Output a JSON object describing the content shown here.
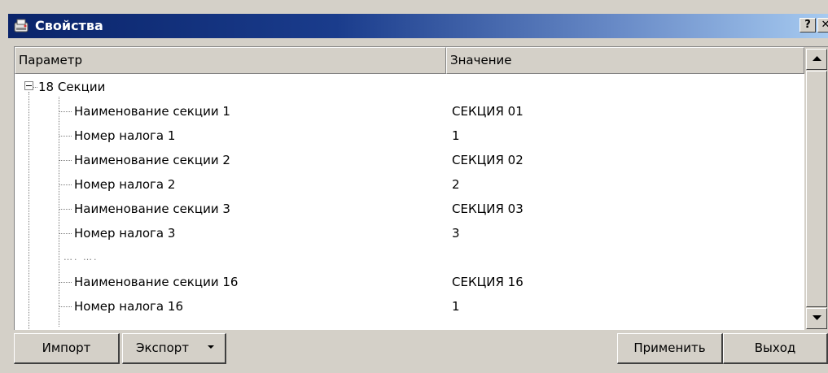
{
  "window": {
    "title": "Свойства",
    "help_label": "?",
    "close_label": "✕"
  },
  "grid": {
    "headers": [
      "Параметр",
      "Значение"
    ],
    "root": {
      "label": "18 Секции"
    },
    "rows": [
      {
        "label": "Наименование секции 1",
        "value": "СЕКЦИЯ 01"
      },
      {
        "label": "Номер налога 1",
        "value": "1"
      },
      {
        "label": "Наименование секции 2",
        "value": "СЕКЦИЯ 02"
      },
      {
        "label": "Номер налога 2",
        "value": "2"
      },
      {
        "label": "Наименование секции 3",
        "value": "СЕКЦИЯ 03"
      },
      {
        "label": "Номер налога 3",
        "value": "3"
      },
      {
        "label": "…. ….",
        "value": ""
      },
      {
        "label": "Наименование секции 16",
        "value": "СЕКЦИЯ 16"
      },
      {
        "label": "Номер налога 16",
        "value": "1"
      }
    ]
  },
  "buttons": {
    "import": "Импорт",
    "export": "Экспорт",
    "apply": "Применить",
    "exit": "Выход"
  }
}
